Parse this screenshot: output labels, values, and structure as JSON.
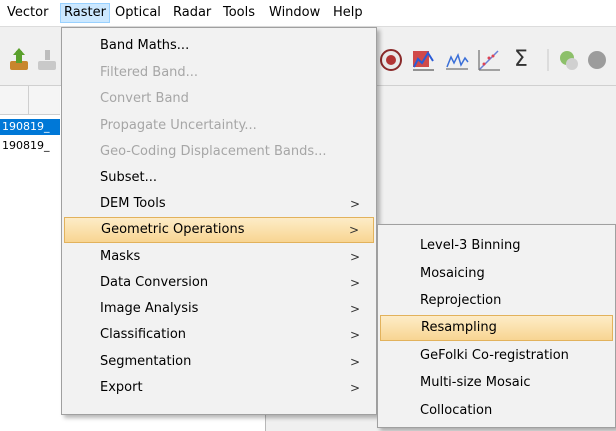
{
  "menubar": {
    "items": [
      {
        "label": "Vector"
      },
      {
        "label": "Raster"
      },
      {
        "label": "Optical"
      },
      {
        "label": "Radar"
      },
      {
        "label": "Tools"
      },
      {
        "label": "Window"
      },
      {
        "label": "Help"
      }
    ],
    "active": "Raster"
  },
  "toolbar": {
    "icons": [
      "upload-icon",
      "download-icon",
      "information-icon",
      "spectrum-view-icon",
      "profile-plot-icon",
      "scatter-plot-icon",
      "statistics-sigma-icon",
      "mask-icon"
    ],
    "sigma_glyph": "Σ"
  },
  "product_list": {
    "rows": [
      {
        "label": "190819_",
        "selected": true
      },
      {
        "label": "190819_",
        "selected": false
      }
    ]
  },
  "raster_menu": {
    "items": [
      {
        "label": "Band Maths...",
        "enabled": true,
        "submenu": false
      },
      {
        "label": "Filtered Band...",
        "enabled": false,
        "submenu": false
      },
      {
        "label": "Convert Band",
        "enabled": false,
        "submenu": false
      },
      {
        "label": "Propagate Uncertainty...",
        "enabled": false,
        "submenu": false
      },
      {
        "label": "Geo-Coding Displacement Bands...",
        "enabled": false,
        "submenu": false
      },
      {
        "label": "Subset...",
        "enabled": true,
        "submenu": false
      },
      {
        "label": "DEM Tools",
        "enabled": true,
        "submenu": true
      },
      {
        "label": "Geometric Operations",
        "enabled": true,
        "submenu": true,
        "highlighted": true
      },
      {
        "label": "Masks",
        "enabled": true,
        "submenu": true
      },
      {
        "label": "Data Conversion",
        "enabled": true,
        "submenu": true
      },
      {
        "label": "Image Analysis",
        "enabled": true,
        "submenu": true
      },
      {
        "label": "Classification",
        "enabled": true,
        "submenu": true
      },
      {
        "label": "Segmentation",
        "enabled": true,
        "submenu": true
      },
      {
        "label": "Export",
        "enabled": true,
        "submenu": true
      }
    ],
    "arrow_glyph": ">"
  },
  "geometric_submenu": {
    "items": [
      {
        "label": "Level-3 Binning"
      },
      {
        "label": "Mosaicing"
      },
      {
        "label": "Reprojection"
      },
      {
        "label": "Resampling",
        "highlighted": true
      },
      {
        "label": "GeFolki Co-registration"
      },
      {
        "label": "Multi-size Mosaic"
      },
      {
        "label": "Collocation"
      }
    ]
  },
  "colors": {
    "menu_highlight": "#fbe3b5",
    "menu_highlight_border": "#e2b25c",
    "selection_blue": "#0078d7",
    "disabled_text": "#a6a6a6"
  }
}
